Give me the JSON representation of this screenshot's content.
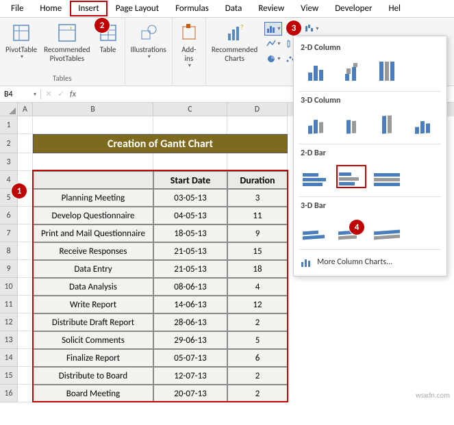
{
  "ribbon_tabs": [
    "File",
    "Home",
    "Insert",
    "Page Layout",
    "Formulas",
    "Data",
    "Review",
    "View",
    "Developer",
    "Hel"
  ],
  "groups": {
    "tables": {
      "label": "Tables",
      "pivot": "PivotTable",
      "recpivot": "Recommended\nPivotTables",
      "table": "Table"
    },
    "illustrations": "Illustrations",
    "addins": "Add-\nins",
    "reccharts": "Recommended\nCharts"
  },
  "chart_menu": {
    "col2d": "2-D Column",
    "col3d": "3-D Column",
    "bar2d": "2-D Bar",
    "bar3d": "3-D Bar",
    "more": "More Column Charts..."
  },
  "name_box": "B4",
  "columns": [
    "A",
    "B",
    "C",
    "D"
  ],
  "title": "Creation of Gantt Chart",
  "headers": {
    "b": "",
    "c": "Start Date",
    "d": "Duration"
  },
  "rows": [
    {
      "b": "Planning Meeting",
      "c": "03-05-13",
      "d": "3"
    },
    {
      "b": "Develop Questionnaire",
      "c": "04-05-13",
      "d": "11"
    },
    {
      "b": "Print and Mail Questionnaire",
      "c": "18-05-13",
      "d": "9"
    },
    {
      "b": "Receive Responses",
      "c": "21-05-13",
      "d": "15"
    },
    {
      "b": "Data Entry",
      "c": "21-05-13",
      "d": "18"
    },
    {
      "b": "Data Analysis",
      "c": "08-06-13",
      "d": "4"
    },
    {
      "b": "Write Report",
      "c": "14-06-13",
      "d": "12"
    },
    {
      "b": "Distribute Draft Report",
      "c": "28-06-13",
      "d": "2"
    },
    {
      "b": "Solicit Comments",
      "c": "29-06-13",
      "d": "5"
    },
    {
      "b": "Finalize Report",
      "c": "05-07-13",
      "d": "6"
    },
    {
      "b": "Distribute to Board",
      "c": "12-07-13",
      "d": "2"
    },
    {
      "b": "Board Meeting",
      "c": "20-07-13",
      "d": "2"
    }
  ],
  "row_numbers": [
    "1",
    "2",
    "3",
    "4",
    "5",
    "6",
    "7",
    "8",
    "9",
    "10",
    "11",
    "12",
    "13",
    "14",
    "15",
    "16"
  ],
  "steps": {
    "1": "1",
    "2": "2",
    "3": "3",
    "4": "4"
  },
  "watermark": "wsxdn.com"
}
